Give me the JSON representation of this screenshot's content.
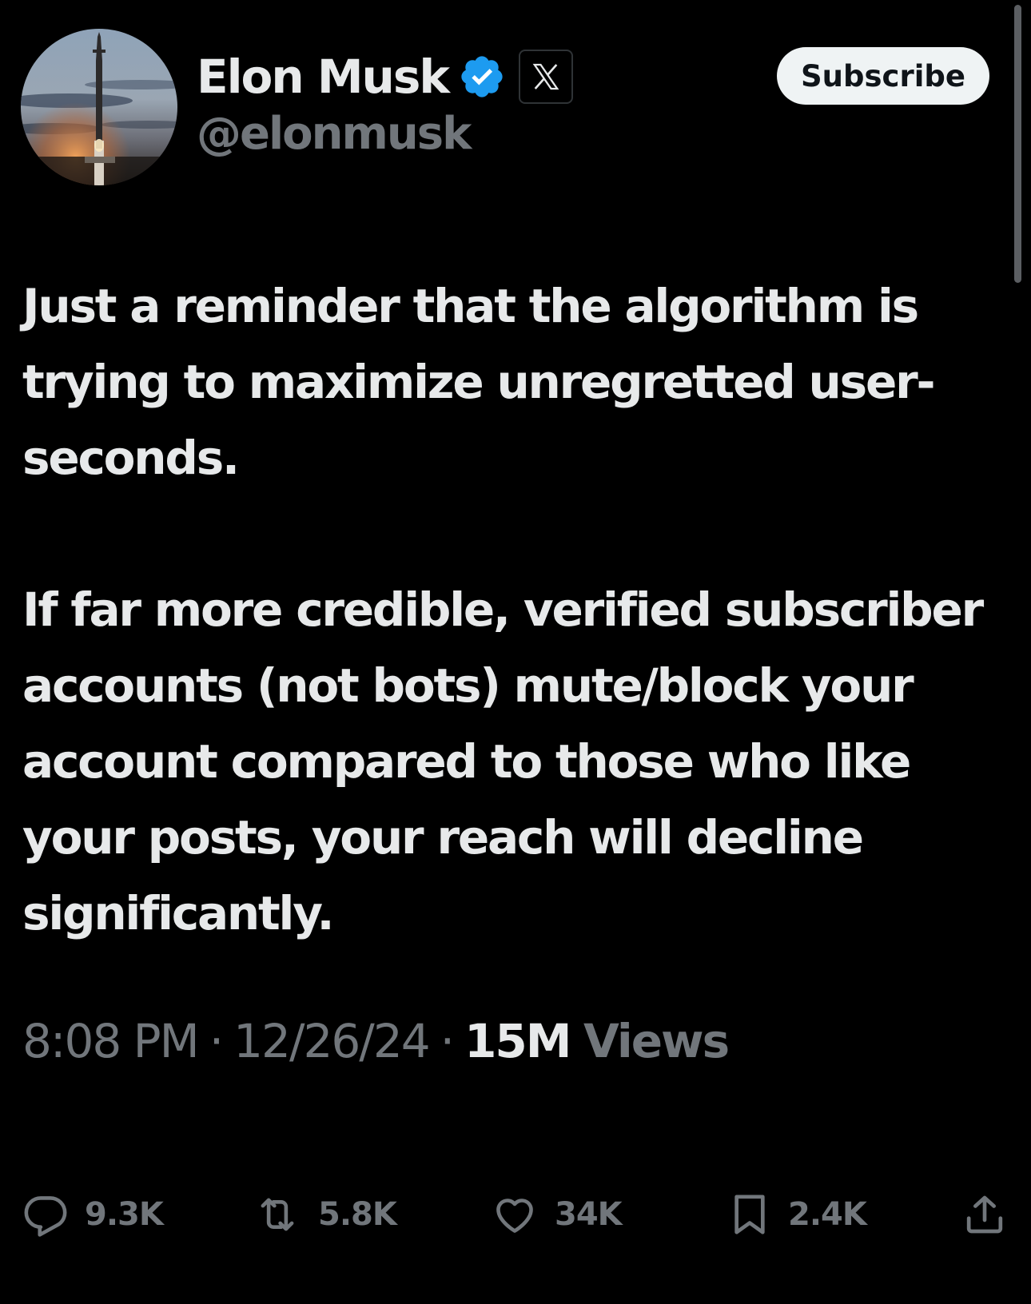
{
  "author": {
    "display_name": "Elon Musk",
    "handle": "@elonmusk",
    "verified_badge_color": "#1d9bf0",
    "avatar_icon": "rocket-launch-avatar",
    "affiliate_icon": "x-logo-icon"
  },
  "subscribe": {
    "label": "Subscribe"
  },
  "tweet": {
    "paragraphs": [
      "Just a reminder that the algorithm is trying to maximize unregretted user-seconds.",
      "If far more credible, verified subscriber accounts (not bots) mute/block your account compared to those who like your posts, your reach will decline significantly."
    ],
    "time": "8:08 PM",
    "date": "12/26/24",
    "separator": "·",
    "views_count": "15M",
    "views_label": "Views"
  },
  "actions": {
    "replies": "9.3K",
    "reposts": "5.8K",
    "likes": "34K",
    "bookmarks": "2.4K"
  },
  "colors": {
    "background": "#000000",
    "primary_text": "#e7e9ea",
    "secondary_text": "#71767b",
    "accent": "#1d9bf0",
    "button_bg": "#eff3f4"
  }
}
